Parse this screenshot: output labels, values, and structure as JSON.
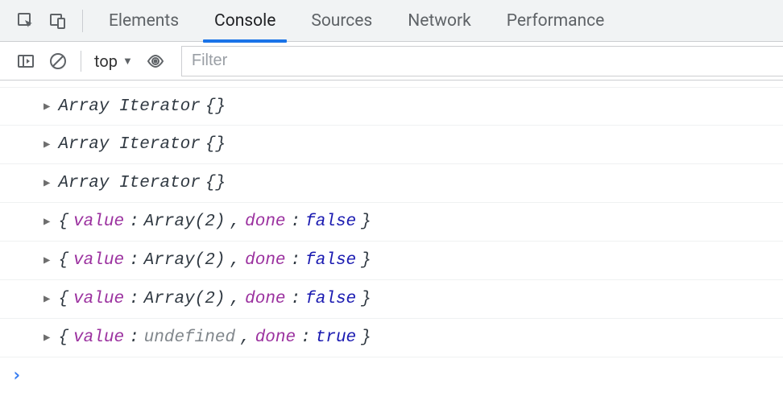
{
  "tabs": {
    "items": [
      "Elements",
      "Console",
      "Sources",
      "Network",
      "Performance"
    ],
    "active_index": 1
  },
  "toolbar": {
    "context": "top",
    "filter_placeholder": "Filter"
  },
  "console": {
    "logs": [
      {
        "type": "iterator",
        "label": "Array Iterator",
        "suffix": "{}"
      },
      {
        "type": "iterator",
        "label": "Array Iterator",
        "suffix": "{}"
      },
      {
        "type": "iterator",
        "label": "Array Iterator",
        "suffix": "{}"
      },
      {
        "type": "object",
        "value_label": "value",
        "value": "Array(2)",
        "done_label": "done",
        "done": "false",
        "done_kind": "bool"
      },
      {
        "type": "object",
        "value_label": "value",
        "value": "Array(2)",
        "done_label": "done",
        "done": "false",
        "done_kind": "bool"
      },
      {
        "type": "object",
        "value_label": "value",
        "value": "Array(2)",
        "done_label": "done",
        "done": "false",
        "done_kind": "bool"
      },
      {
        "type": "object",
        "value_label": "value",
        "value": "undefined",
        "value_kind": "undef",
        "done_label": "done",
        "done": "true",
        "done_kind": "bool"
      }
    ],
    "prompt": ""
  }
}
